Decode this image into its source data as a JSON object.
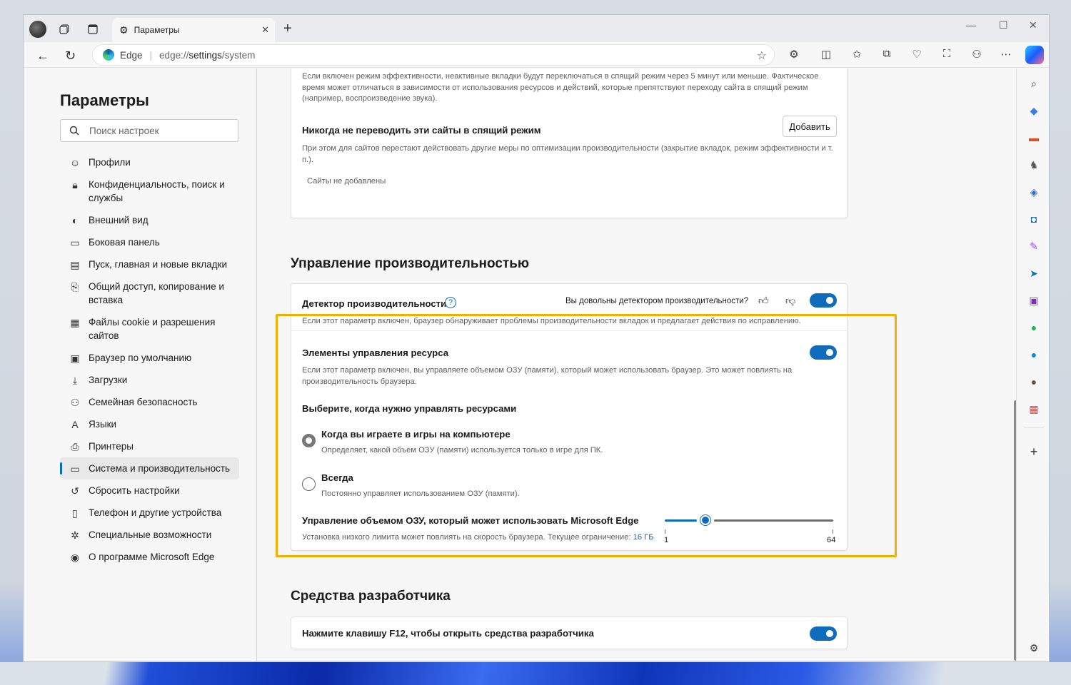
{
  "browser": {
    "tab_title": "Параметры",
    "address_brand": "Edge",
    "url_prefix": "edge://",
    "url_main": "settings",
    "url_suffix": "/system"
  },
  "sidebar": {
    "title": "Параметры",
    "search_placeholder": "Поиск настроек",
    "items": [
      {
        "label": "Профили",
        "icon": "profile-icon"
      },
      {
        "label": "Конфиденциальность, поиск и службы",
        "icon": "lock-icon"
      },
      {
        "label": "Внешний вид",
        "icon": "appearance-icon"
      },
      {
        "label": "Боковая панель",
        "icon": "sidebar-icon"
      },
      {
        "label": "Пуск, главная и новые вкладки",
        "icon": "home-icon"
      },
      {
        "label": "Общий доступ, копирование и вставка",
        "icon": "share-icon"
      },
      {
        "label": "Файлы cookie и разрешения сайтов",
        "icon": "cookie-icon"
      },
      {
        "label": "Браузер по умолчанию",
        "icon": "browser-icon"
      },
      {
        "label": "Загрузки",
        "icon": "download-icon"
      },
      {
        "label": "Семейная безопасность",
        "icon": "family-icon"
      },
      {
        "label": "Языки",
        "icon": "language-icon"
      },
      {
        "label": "Принтеры",
        "icon": "printer-icon"
      },
      {
        "label": "Система и производительность",
        "icon": "system-icon",
        "active": true
      },
      {
        "label": "Сбросить настройки",
        "icon": "reset-icon"
      },
      {
        "label": "Телефон и другие устройства",
        "icon": "phone-icon"
      },
      {
        "label": "Специальные возможности",
        "icon": "accessibility-icon"
      },
      {
        "label": "О программе Microsoft Edge",
        "icon": "edge-icon"
      }
    ]
  },
  "sleeping": {
    "intro_text": "Если включен режим эффективности, неактивные вкладки будут переключаться в спящий режим через 5 минут или меньше. Фактическое время может отличаться в зависимости от использования ресурсов и действий, которые препятствуют переходу сайта в спящий режим (например, воспроизведение звука).",
    "never_title": "Никогда не переводить эти сайты в спящий режим",
    "never_desc": "При этом для сайтов перестают действовать другие меры по оптимизации производительности (закрытие вкладок, режим эффективности и т. п.).",
    "add_button": "Добавить",
    "empty_text": "Сайты не добавлены"
  },
  "performance": {
    "heading": "Управление производительностью",
    "detector_title": "Детектор производительности",
    "feedback_question": "Вы довольны детектором производительности?",
    "detector_desc": "Если этот параметр включен, браузер обнаруживает проблемы производительности вкладок и предлагает действия по исправлению.",
    "detector_on": true,
    "resource_title": "Элементы управления ресурса",
    "resource_desc": "Если этот параметр включен, вы управляете объемом ОЗУ (памяти), который может использовать браузер. Это может повлиять на производительность браузера.",
    "resource_on": true,
    "choose_title": "Выберите, когда нужно управлять ресурсами",
    "options": [
      {
        "title": "Когда вы играете в игры на компьютере",
        "desc": "Определяет, какой объем ОЗУ (памяти) используется только в игре для ПК.",
        "selected": true
      },
      {
        "title": "Всегда",
        "desc": "Постоянно управляет использованием ОЗУ (памяти).",
        "selected": false
      }
    ],
    "ram_title": "Управление объемом ОЗУ, который может использовать Microsoft Edge",
    "ram_desc": "Установка низкого лимита может повлиять на скорость браузера. Текущее ограничение:",
    "ram_limit": "16 ГБ",
    "slider_min": "1",
    "slider_max": "64",
    "slider_fraction": 0.24
  },
  "devtools": {
    "heading": "Средства разработчика",
    "f12_title": "Нажмите клавишу F12, чтобы открыть средства разработчика",
    "f12_on": true
  },
  "colors": {
    "accent": "#0f6cbd",
    "highlight": "#f0b000"
  }
}
